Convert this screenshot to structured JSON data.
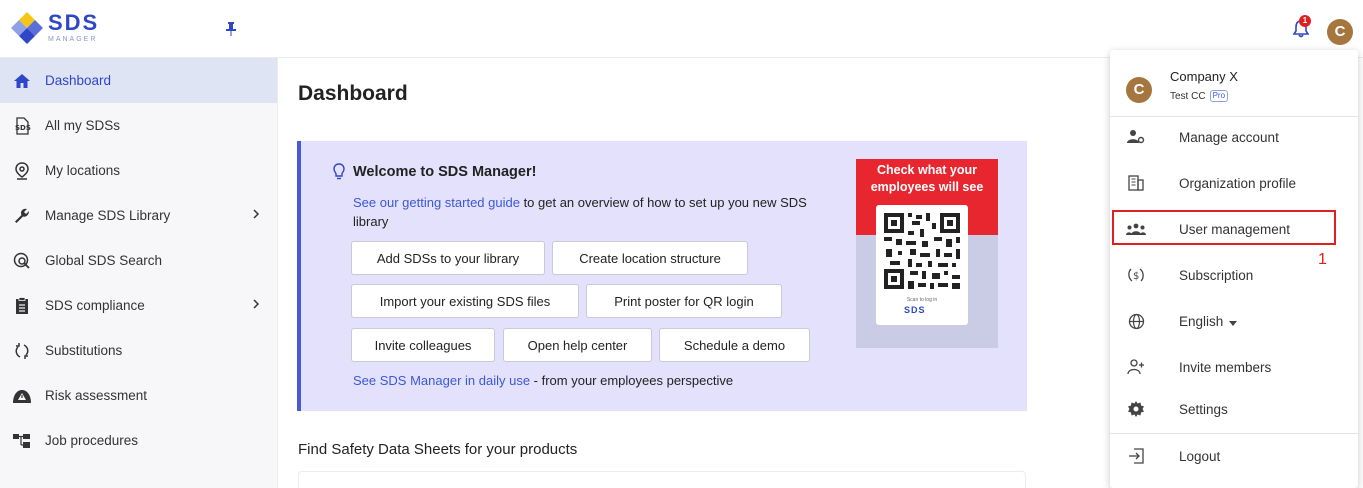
{
  "brand": {
    "name": "SDS",
    "sub": "MANAGER",
    "accent": "#2f46c8"
  },
  "header": {
    "notification_count": "1",
    "avatar_initial": "C"
  },
  "sidebar": {
    "items": [
      {
        "label": "Dashboard",
        "icon": "home-icon",
        "active": true
      },
      {
        "label": "All my SDSs",
        "icon": "sds-icon"
      },
      {
        "label": "My locations",
        "icon": "location-pin-icon"
      },
      {
        "label": "Manage SDS Library",
        "icon": "wrench-icon",
        "chevron": true
      },
      {
        "label": "Global SDS Search",
        "icon": "global-search-icon"
      },
      {
        "label": "SDS compliance",
        "icon": "clipboard-icon",
        "chevron": true
      },
      {
        "label": "Substitutions",
        "icon": "swap-icon"
      },
      {
        "label": "Risk assessment",
        "icon": "warning-icon"
      },
      {
        "label": "Job procedures",
        "icon": "procedures-icon"
      }
    ]
  },
  "main": {
    "title": "Dashboard",
    "welcome": {
      "title": "Welcome to SDS Manager!",
      "guide_link": "See our getting started guide",
      "guide_text": " to get an overview of how to set up you new SDS library",
      "buttons": [
        "Add SDSs to your library",
        "Create location structure",
        "Import your existing SDS files",
        "Print poster for QR login",
        "Invite colleagues",
        "Open help center",
        "Schedule a demo"
      ],
      "daily_link": "See SDS Manager in daily use",
      "daily_text": " - from your employees perspective"
    },
    "poster": {
      "text": "Check what your employees will see",
      "caption": "Scan to log in",
      "logo": "SDS"
    },
    "find_title": "Find Safety Data Sheets for your products"
  },
  "account_menu": {
    "avatar_initial": "C",
    "company": "Company X",
    "sub": "Test CC",
    "plan_badge": "Pro",
    "items": [
      {
        "label": "Manage account",
        "icon": "manage-account-icon"
      },
      {
        "label": "Organization profile",
        "icon": "organization-icon"
      },
      {
        "label": "User management",
        "icon": "users-icon",
        "highlighted": true
      },
      {
        "label": "Subscription",
        "icon": "subscription-icon"
      },
      {
        "label": "English",
        "icon": "globe-icon",
        "dropdown": true
      },
      {
        "label": "Invite members",
        "icon": "invite-icon"
      },
      {
        "label": "Settings",
        "icon": "gear-icon"
      },
      {
        "label": "Logout",
        "icon": "logout-icon"
      }
    ],
    "annotation": "1"
  }
}
